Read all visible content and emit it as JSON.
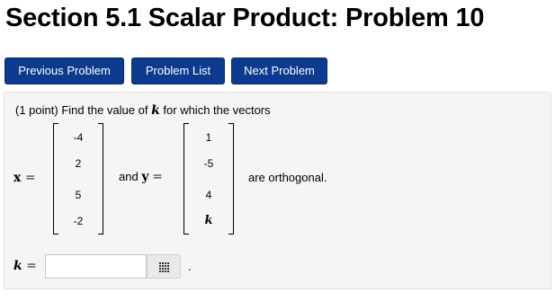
{
  "header": {
    "title": "Section 5.1 Scalar Product: Problem 10"
  },
  "nav": {
    "previous_label": "Previous Problem",
    "list_label": "Problem List",
    "next_label": "Next Problem"
  },
  "colors": {
    "button_bg": "#0b3a8e",
    "panel_bg": "#f5f5f5"
  },
  "problem": {
    "points": "(1 point)",
    "prompt_before": "Find the value of",
    "variable": "k",
    "prompt_after": "for which the vectors",
    "x_label": "x",
    "y_label": "y",
    "equals": "=",
    "and_text": "and",
    "orthogonal_text": "are orthogonal.",
    "x_vector": [
      "-4",
      "2",
      "5",
      "-2"
    ],
    "y_vector": [
      "1",
      "-5",
      "4",
      "k"
    ],
    "answer": {
      "label": "k",
      "value": "",
      "trailing": "."
    },
    "tool_icon": "matrix-grid-icon"
  }
}
